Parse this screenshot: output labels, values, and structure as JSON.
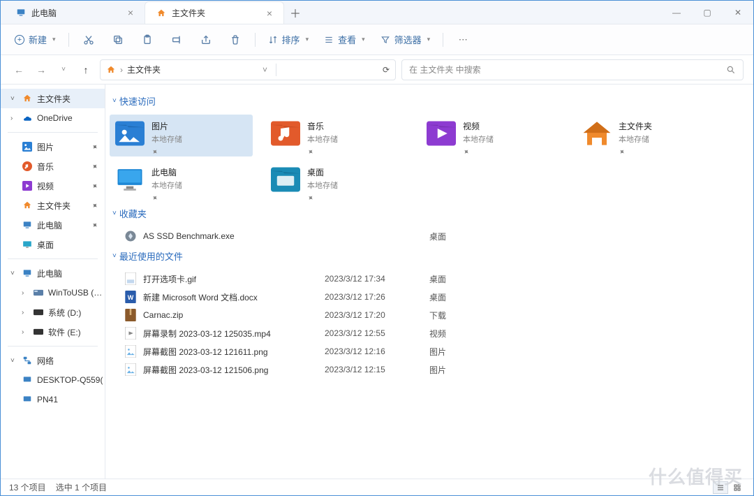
{
  "tabs": [
    {
      "label": "此电脑",
      "active": false
    },
    {
      "label": "主文件夹",
      "active": true
    }
  ],
  "toolbar": {
    "new_label": "新建",
    "sort_label": "排序",
    "view_label": "查看",
    "filter_label": "筛选器"
  },
  "breadcrumb": {
    "current": "主文件夹"
  },
  "search": {
    "placeholder": "在 主文件夹 中搜索"
  },
  "sidebar": {
    "top": [
      {
        "label": "主文件夹",
        "icon": "home",
        "selected": true,
        "pinned": false
      },
      {
        "label": "OneDrive",
        "icon": "onedrive",
        "expand": true
      }
    ],
    "quick": [
      {
        "label": "图片",
        "icon": "pictures",
        "pinned": true
      },
      {
        "label": "音乐",
        "icon": "music",
        "pinned": true
      },
      {
        "label": "视频",
        "icon": "video",
        "pinned": true
      },
      {
        "label": "主文件夹",
        "icon": "home",
        "pinned": true
      },
      {
        "label": "此电脑",
        "icon": "pc",
        "pinned": true
      },
      {
        "label": "桌面",
        "icon": "desktop"
      }
    ],
    "pc_label": "此电脑",
    "drives": [
      {
        "label": "WinToUSB (C:)",
        "icon": "drive"
      },
      {
        "label": "系统 (D:)",
        "icon": "drive-dark"
      },
      {
        "label": "软件 (E:)",
        "icon": "drive-dark"
      }
    ],
    "network_label": "网络",
    "network": [
      {
        "label": "DESKTOP-Q559("
      },
      {
        "label": "PN41"
      }
    ]
  },
  "sections": {
    "quick_access": "快速访问",
    "favorites": "收藏夹",
    "recent": "最近使用的文件"
  },
  "quick_access_items": [
    {
      "name": "图片",
      "sub": "本地存储",
      "icon": "pictures",
      "selected": true
    },
    {
      "name": "音乐",
      "sub": "本地存储",
      "icon": "music-folder"
    },
    {
      "name": "视频",
      "sub": "本地存储",
      "icon": "video-folder"
    },
    {
      "name": "主文件夹",
      "sub": "本地存储",
      "icon": "home-big"
    },
    {
      "name": "此电脑",
      "sub": "本地存储",
      "icon": "pc-big"
    },
    {
      "name": "桌面",
      "sub": "本地存储",
      "icon": "desktop-folder"
    }
  ],
  "favorites": [
    {
      "name": "AS SSD Benchmark.exe",
      "location": "桌面",
      "icon": "exe"
    }
  ],
  "recent": [
    {
      "name": "打开选项卡.gif",
      "date": "2023/3/12 17:34",
      "location": "桌面",
      "icon": "gif"
    },
    {
      "name": "新建 Microsoft Word 文档.docx",
      "date": "2023/3/12 17:26",
      "location": "桌面",
      "icon": "word"
    },
    {
      "name": "Carnac.zip",
      "date": "2023/3/12 17:20",
      "location": "下载",
      "icon": "zip"
    },
    {
      "name": "屏幕录制 2023-03-12 125035.mp4",
      "date": "2023/3/12 12:55",
      "location": "视频",
      "icon": "mp4"
    },
    {
      "name": "屏幕截图 2023-03-12 121611.png",
      "date": "2023/3/12 12:16",
      "location": "图片",
      "icon": "png"
    },
    {
      "name": "屏幕截图 2023-03-12 121506.png",
      "date": "2023/3/12 12:15",
      "location": "图片",
      "icon": "png"
    }
  ],
  "status": {
    "count": "13 个项目",
    "selection": "选中 1 个项目"
  },
  "watermark": "什么值得买"
}
